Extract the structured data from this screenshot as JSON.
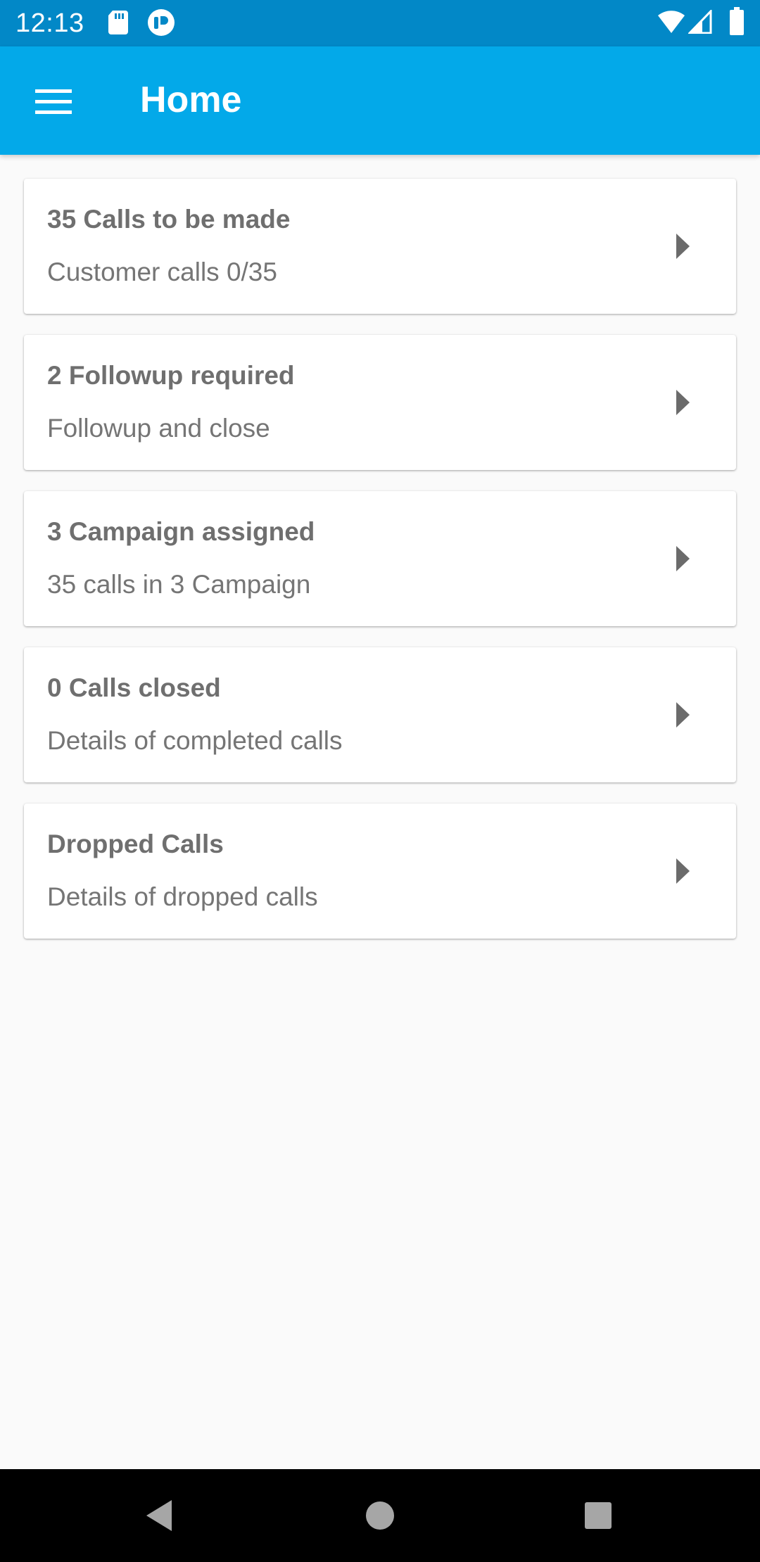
{
  "status_bar": {
    "time": "12:13",
    "left_icons": [
      "sd-card-icon",
      "notification-app-icon"
    ],
    "right_icons": [
      "wifi-icon",
      "signal-icon",
      "battery-icon"
    ]
  },
  "app_bar": {
    "title": "Home",
    "menu_icon": "menu-icon",
    "color": "#03a9e9"
  },
  "cards": [
    {
      "title": "35 Calls to be made",
      "subtitle": "Customer calls 0/35",
      "icon": "chevron-right-icon"
    },
    {
      "title": "2 Followup required",
      "subtitle": "Followup and close",
      "icon": "chevron-right-icon"
    },
    {
      "title": "3 Campaign assigned",
      "subtitle": "35 calls in 3 Campaign",
      "icon": "chevron-right-icon"
    },
    {
      "title": "0 Calls closed",
      "subtitle": "Details of completed calls",
      "icon": "chevron-right-icon"
    },
    {
      "title": "Dropped Calls",
      "subtitle": "Details of dropped calls",
      "icon": "chevron-right-icon"
    }
  ],
  "nav_bar": {
    "buttons": [
      "back-icon",
      "home-icon",
      "recents-icon"
    ]
  }
}
